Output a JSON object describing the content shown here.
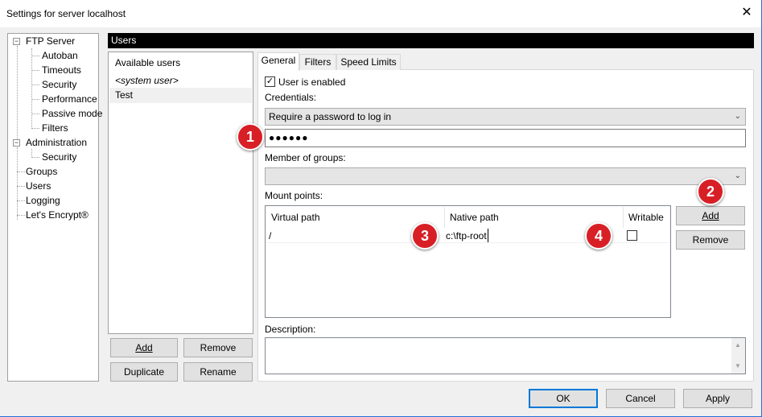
{
  "window": {
    "title": "Settings for server localhost",
    "close_glyph": "✕"
  },
  "tree": {
    "items": [
      {
        "label": "FTP Server",
        "expander": "⊟"
      },
      {
        "label": "Autoban"
      },
      {
        "label": "Timeouts"
      },
      {
        "label": "Security"
      },
      {
        "label": "Performance"
      },
      {
        "label": "Passive mode"
      },
      {
        "label": "Filters"
      },
      {
        "label": "Administration",
        "expander": "⊟"
      },
      {
        "label": "Security"
      },
      {
        "label": "Groups"
      },
      {
        "label": "Users"
      },
      {
        "label": "Logging"
      },
      {
        "label": "Let's Encrypt®"
      }
    ]
  },
  "page_header": "Users",
  "users": {
    "header": "Available users",
    "items": [
      "<system user>",
      "Test"
    ],
    "buttons": {
      "add": "Add",
      "remove": "Remove",
      "duplicate": "Duplicate",
      "rename": "Rename"
    }
  },
  "tabs": [
    "General",
    "Filters",
    "Speed Limits"
  ],
  "general": {
    "user_enabled_label": "User is enabled",
    "user_enabled_checked": "✓",
    "credentials_label": "Credentials:",
    "credentials_value": "Require a password to log in",
    "password_value": "●●●●●●",
    "groups_label": "Member of groups:",
    "groups_value": "",
    "mount_points_label": "Mount points:",
    "mount_columns": [
      "Virtual path",
      "Native path",
      "Writable"
    ],
    "mount_rows": [
      {
        "virtual": "/",
        "native": "c:\\ftp-root",
        "writable": ""
      }
    ],
    "mount_add": "Add",
    "mount_remove": "Remove",
    "description_label": "Description:"
  },
  "footer": {
    "ok": "OK",
    "cancel": "Cancel",
    "apply": "Apply"
  },
  "badges": [
    "1",
    "2",
    "3",
    "4"
  ],
  "colors": {
    "badge": "#d81f26",
    "header_bar": "#000000",
    "default_button_border": "#0078d7"
  },
  "icons": {
    "dropdown": "⌄"
  }
}
